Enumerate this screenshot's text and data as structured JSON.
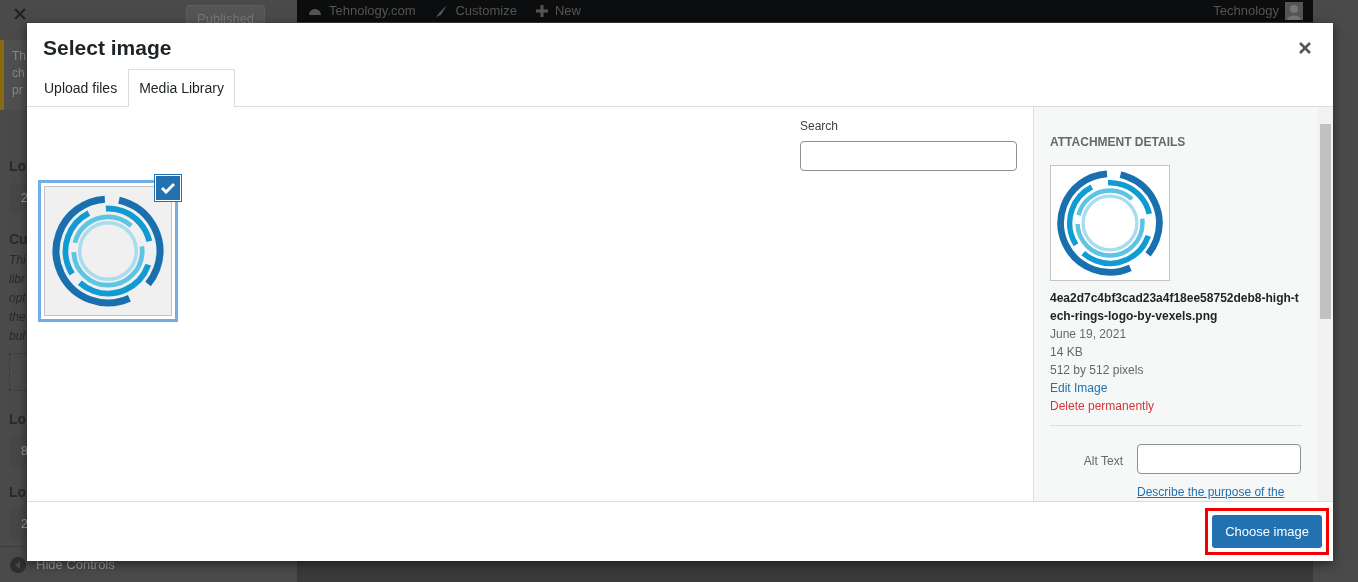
{
  "customizer": {
    "published_button": "Published",
    "notice_lines": [
      "Th",
      "ch",
      "pr"
    ],
    "controls": [
      {
        "kind": "heading",
        "text": "Lo"
      },
      {
        "kind": "input",
        "text": "2"
      },
      {
        "kind": "heading",
        "text": "Cu"
      },
      {
        "kind": "italic",
        "text": "Thi"
      },
      {
        "kind": "italic",
        "text": "libr"
      },
      {
        "kind": "italic",
        "text": "opt"
      },
      {
        "kind": "italic",
        "text": "the"
      },
      {
        "kind": "italic",
        "text": "bul"
      },
      {
        "kind": "dashed"
      },
      {
        "kind": "heading",
        "text": "Lo"
      },
      {
        "kind": "input",
        "text": "8"
      },
      {
        "kind": "heading",
        "text": "Lo"
      },
      {
        "kind": "input",
        "text": "2"
      }
    ],
    "hide_controls": "Hide Controls"
  },
  "admin_bar": {
    "items": [
      "Tehnology.com",
      "Customize",
      "New"
    ],
    "user": "Technology"
  },
  "modal": {
    "title": "Select image",
    "tabs": [
      {
        "label": "Upload files",
        "selected": false
      },
      {
        "label": "Media Library",
        "selected": true
      }
    ],
    "search": {
      "label": "Search"
    },
    "attachments": [
      {
        "selected": true
      }
    ],
    "details": {
      "heading": "ATTACHMENT DETAILS",
      "filename": "4ea2d7c4bf3cad23a4f18ee58752deb8-high-tech-rings-logo-by-vexels.png",
      "date": "June 19, 2021",
      "size": "14 KB",
      "dimensions": "512 by 512 pixels",
      "edit_link": "Edit Image",
      "delete_link": "Delete permanently",
      "alt_label": "Alt Text",
      "alt_help": "Describe the purpose of the"
    },
    "choose_button": {
      "label": "Choose image",
      "highlighted": true
    }
  }
}
